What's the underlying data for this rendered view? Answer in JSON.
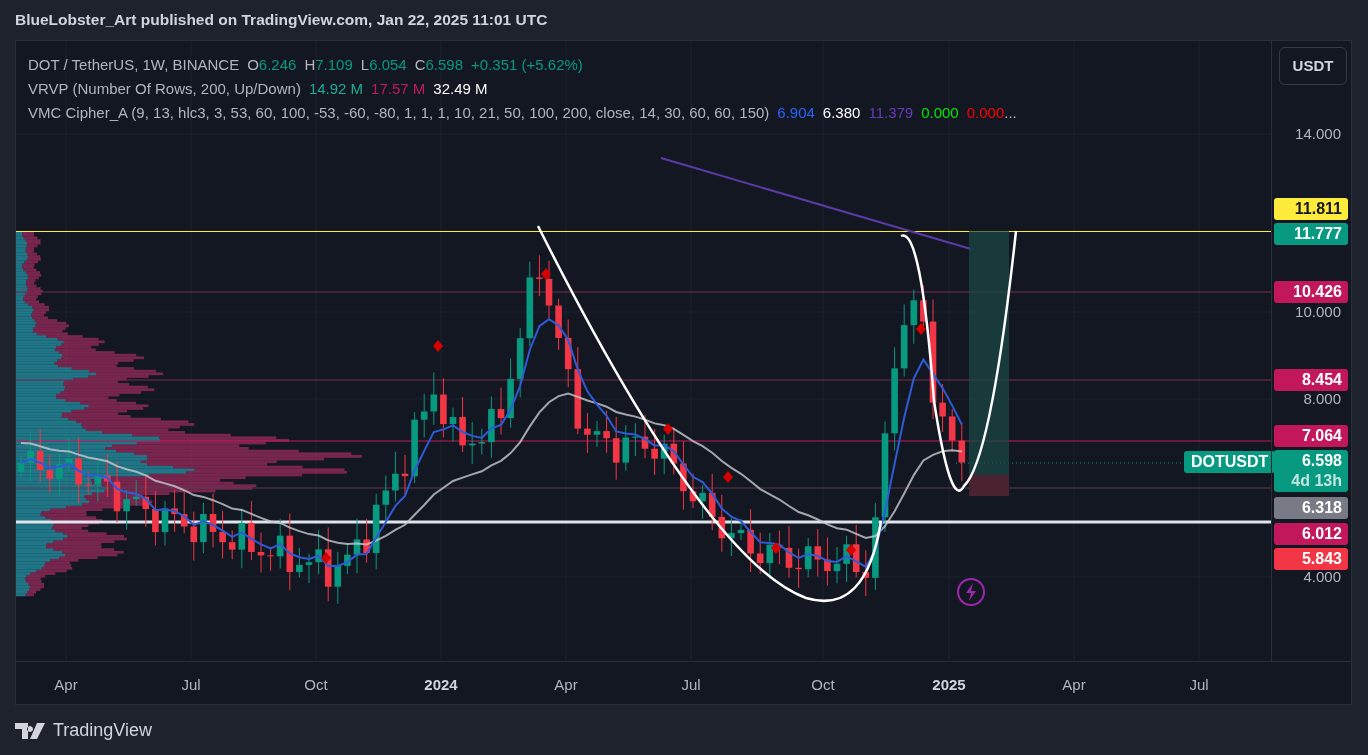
{
  "header": {
    "title": "BlueLobster_Art published on TradingView.com, Jan 22, 2025 11:01 UTC"
  },
  "legend": [
    {
      "name": "DOT / TetherUS, 1W, BINANCE",
      "values": [
        {
          "label": "O",
          "value": "6.246",
          "color": "#089981"
        },
        {
          "label": "H",
          "value": "7.109",
          "color": "#089981"
        },
        {
          "label": "L",
          "value": "6.054",
          "color": "#089981"
        },
        {
          "label": "C",
          "value": "6.598",
          "color": "#089981"
        },
        {
          "value": "+0.351 (+5.62%)",
          "color": "#089981"
        }
      ]
    },
    {
      "name": "VRVP (Number Of Rows, 200, Up/Down)",
      "values": [
        {
          "value": "14.92 M",
          "color": "#22ab94"
        },
        {
          "value": "17.57 M",
          "color": "#c2185b"
        },
        {
          "value": "32.49 M",
          "color": "#ffffff"
        }
      ]
    },
    {
      "name": "VMC Cipher_A (9, 13, hlc3, 3, 53, 60, 100, -53, -60, -80, 1, 1, 1, 10, 21, 50, 100, 200, close, 14, 30, 60, 60, 150)",
      "values": [
        {
          "value": "6.904",
          "color": "#2962ff"
        },
        {
          "value": "6.380",
          "color": "#ffffff"
        },
        {
          "value": "11.379",
          "color": "#673ab7"
        },
        {
          "value": "0.000",
          "color": "#00e600"
        },
        {
          "value": "0.000",
          "color": "#ff0000"
        }
      ],
      "overflow": "..."
    }
  ],
  "currency_button": "USDT",
  "price_axis": {
    "ticks": [
      "14.000",
      "10.000",
      "8.000",
      "4.000"
    ]
  },
  "price_labels": [
    {
      "text": "11.811",
      "color": "#ffeb3b"
    },
    {
      "text": "11.777",
      "color": "#089981"
    },
    {
      "text": "10.426",
      "color": "#c2185b"
    },
    {
      "text": "8.454",
      "color": "#c2185b"
    },
    {
      "text": "7.064",
      "color": "#c2185b"
    },
    {
      "text": "6.598",
      "sub": "4d 13h",
      "color": "#089981"
    },
    {
      "text": "6.318",
      "color": "#787b86"
    },
    {
      "text": "6.012",
      "color": "#c2185b"
    },
    {
      "text": "5.843",
      "color": "#f23645"
    }
  ],
  "symbol_tag": {
    "text": "DOTUSDT"
  },
  "time_axis": [
    {
      "text": "Apr",
      "year": false
    },
    {
      "text": "Jul",
      "year": false
    },
    {
      "text": "Oct",
      "year": false
    },
    {
      "text": "2024",
      "year": true
    },
    {
      "text": "Apr",
      "year": false
    },
    {
      "text": "Jul",
      "year": false
    },
    {
      "text": "Oct",
      "year": false
    },
    {
      "text": "2025",
      "year": true
    },
    {
      "text": "Apr",
      "year": false
    },
    {
      "text": "Jul",
      "year": false
    }
  ],
  "footer": {
    "logo_text": "TradingView"
  }
}
